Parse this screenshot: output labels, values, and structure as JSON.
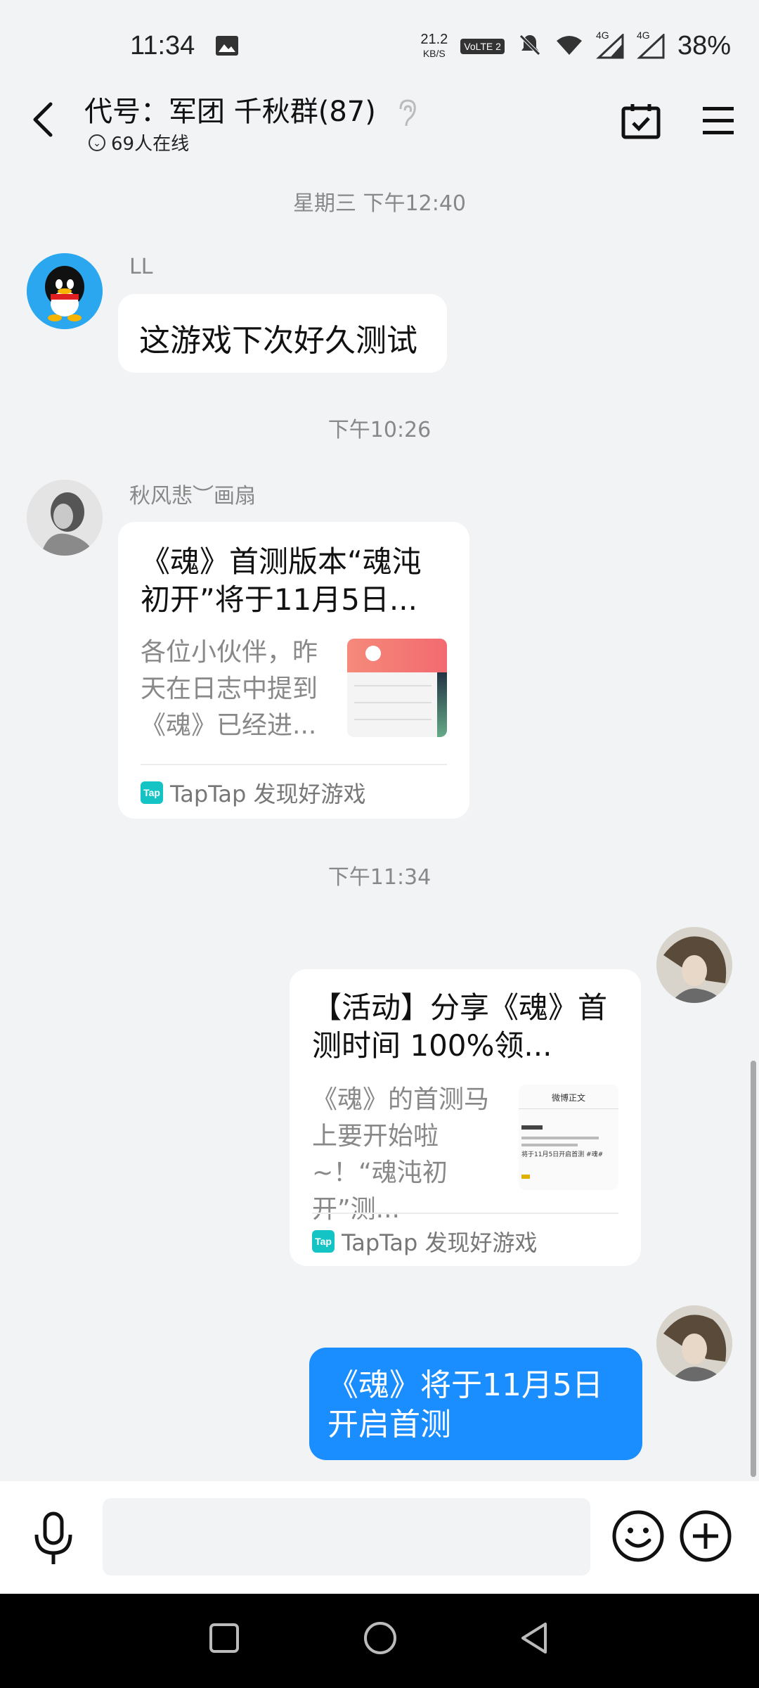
{
  "status_bar": {
    "time": "11:34",
    "speed_value": "21.2",
    "speed_unit": "KB/S",
    "volte": "VoLTE 2",
    "network_1": "4G",
    "network_2": "4G",
    "battery": "38%"
  },
  "header": {
    "title": "代号：军团 千秋群(87)",
    "online": "69人在线"
  },
  "messages": {
    "ts1": "星期三 下午12:40",
    "m1_sender": "LL",
    "m1_text": "这游戏下次好久测试",
    "ts2": "下午10:26",
    "m2_sender": "秋风悲︶画扇",
    "m2_title": "《魂》首测版本“魂沌初开”将于11月5日...",
    "m2_desc": "各位小伙伴，昨天在日志中提到《魂》已经进...",
    "m2_source": "TapTap 发现好游戏",
    "ts3": "下午11:34",
    "m3_title": "【活动】分享《魂》首测时间 100%领...",
    "m3_desc": "《魂》的首测马上要开始啦~！“魂沌初开”测...",
    "m3_source": "TapTap 发现好游戏",
    "m4_text": "《魂》将于11月5日开启首测"
  },
  "thumbs": {
    "m3_thumb_title": "微博正文",
    "m3_thumb_line": "将于11月5日开启首测 #魂#"
  },
  "tap_logo": "Tap",
  "icons": {
    "back": "chevron-left-icon",
    "calendar": "calendar-check-icon",
    "menu": "hamburger-menu-icon",
    "mic": "microphone-icon",
    "emoji": "smiley-icon",
    "plus": "plus-circle-icon"
  },
  "colors": {
    "accent": "#1a8dff",
    "background": "#f2f3f5"
  }
}
